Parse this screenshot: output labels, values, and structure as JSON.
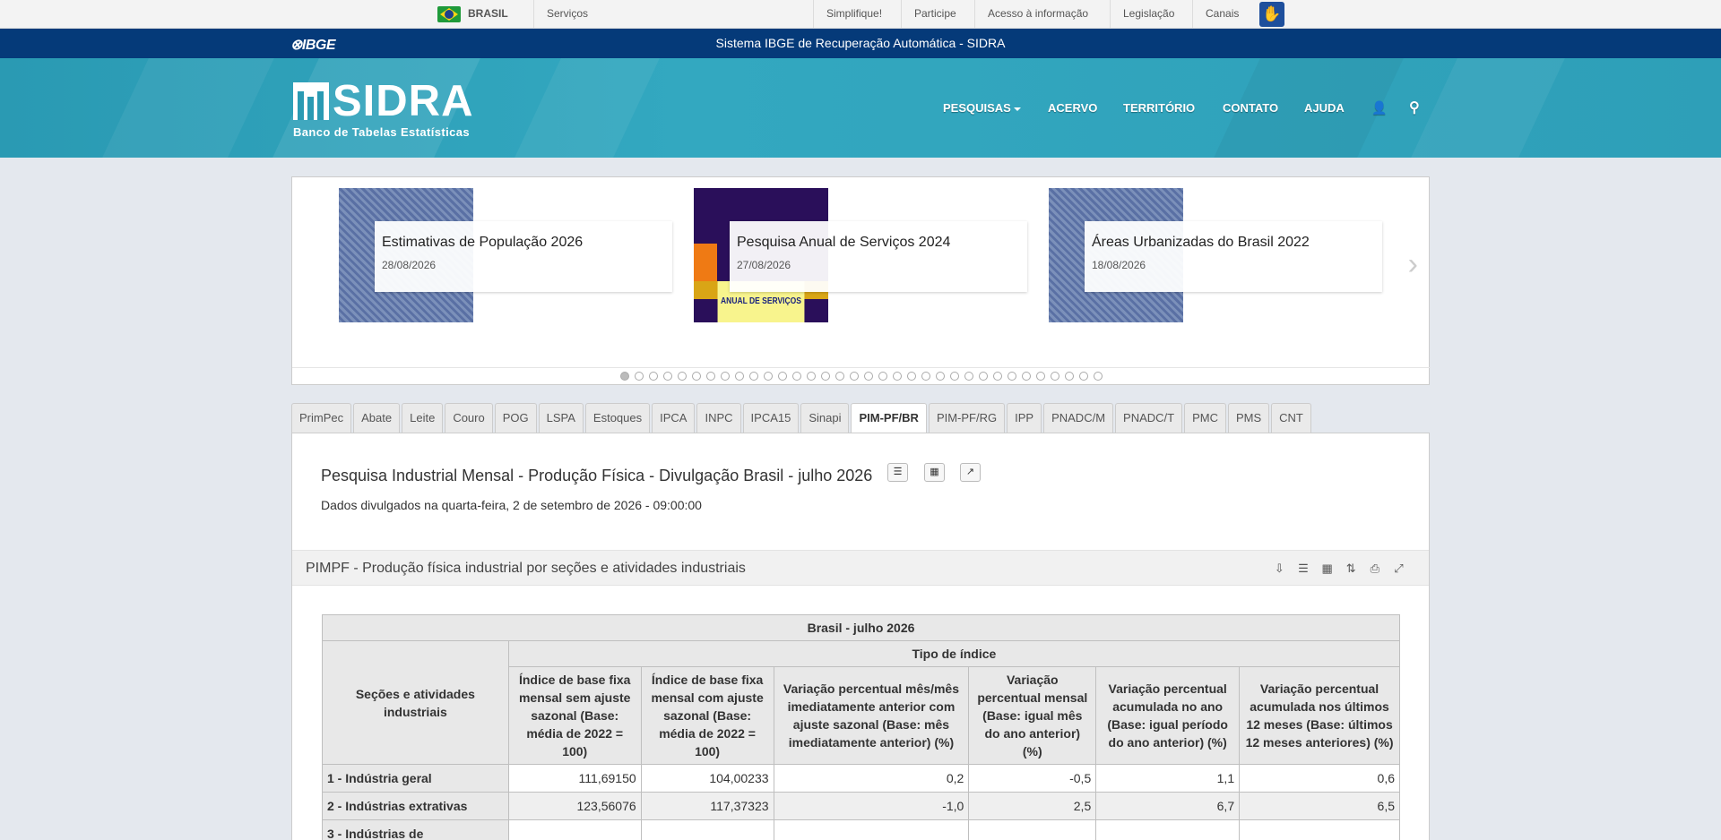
{
  "gov_bar": {
    "country": "BRASIL",
    "services": "Serviços",
    "links": [
      "Simplifique!",
      "Participe",
      "Acesso à informação",
      "Legislação",
      "Canais"
    ]
  },
  "ibge_bar": {
    "logo": "IBGE",
    "title": "Sistema IBGE de Recuperação Automática - SIDRA"
  },
  "header": {
    "logo_word": "SIDRA",
    "logo_sub": "Banco de Tabelas Estatísticas",
    "nav": [
      "PESQUISAS",
      "ACERVO",
      "TERRITÓRIO",
      "CONTATO",
      "AJUDA"
    ]
  },
  "carousel": {
    "slides": [
      {
        "title": "Estimativas de População 2026",
        "date": "28/08/2026"
      },
      {
        "title": "Pesquisa Anual de Serviços 2024",
        "date": "27/08/2026",
        "thumb_text": "ANUAL DE SERVIÇOS"
      },
      {
        "title": "Áreas Urbanizadas do Brasil 2022",
        "date": "18/08/2026"
      }
    ],
    "dot_count": 34,
    "active_dot": 0
  },
  "tabs": [
    "PrimPec",
    "Abate",
    "Leite",
    "Couro",
    "POG",
    "LSPA",
    "Estoques",
    "IPCA",
    "INPC",
    "IPCA15",
    "Sinapi",
    "PIM-PF/BR",
    "PIM-PF/RG",
    "IPP",
    "PNADC/M",
    "PNADC/T",
    "PMC",
    "PMS",
    "CNT"
  ],
  "active_tab": "PIM-PF/BR",
  "page": {
    "title": "Pesquisa Industrial Mensal - Produção Física - Divulgação Brasil - julho 2026",
    "date": "Dados divulgados na quarta-feira, 2 de setembro de 2026 - 09:00:00"
  },
  "table_bar": {
    "title": "PIMPF - Produção física industrial por seções e atividades industriais"
  },
  "table": {
    "region": "Brasil - julho 2026",
    "row_header": "Seções e atividades industriais",
    "group_header": "Tipo de índice",
    "columns": [
      "Índice de base fixa mensal sem ajuste sazonal (Base: média de 2022 = 100)",
      "Índice de base fixa mensal com ajuste sazonal (Base: média de 2022 = 100)",
      "Variação percentual mês/mês imediatamente anterior com ajuste sazonal (Base: mês imediatamente anterior) (%)",
      "Variação percentual mensal (Base: igual mês do ano anterior) (%)",
      "Variação percentual acumulada no ano (Base: igual período do ano anterior) (%)",
      "Variação percentual acumulada nos últimos 12 meses (Base: últimos 12 meses anteriores) (%)"
    ],
    "rows": [
      {
        "label": "1 - Indústria geral",
        "values": [
          "111,69150",
          "104,00233",
          "0,2",
          "-0,5",
          "1,1",
          "0,6"
        ]
      },
      {
        "label": "2 - Indústrias extrativas",
        "values": [
          "123,56076",
          "117,37323",
          "-1,0",
          "2,5",
          "6,7",
          "6,5"
        ]
      },
      {
        "label": "3 - Indústrias de",
        "values": [
          "",
          "",
          "",
          "",
          "",
          ""
        ]
      }
    ]
  }
}
